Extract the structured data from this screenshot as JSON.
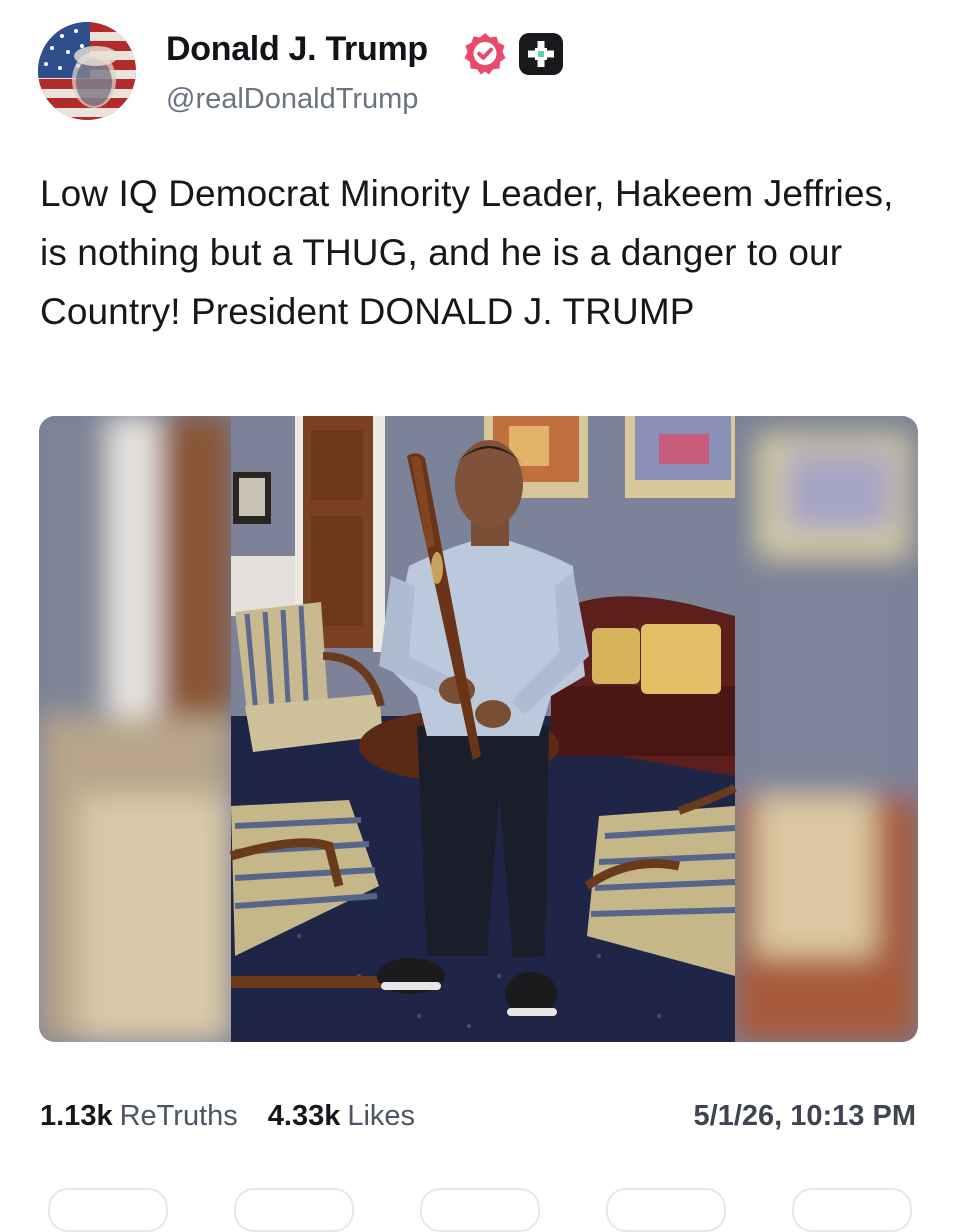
{
  "author": {
    "display_name": "Donald J. Trump",
    "handle": "@realDonaldTrump",
    "verified_icon": "verified-badge-icon",
    "plus_icon": "plus-badge-icon",
    "badge_color": "#e8496d"
  },
  "post": {
    "text": "Low IQ Democrat Minority Leader, Hakeem Jeffries, is nothing but a THUG, and he is a danger to our Country! President DONALD J. TRUMP"
  },
  "stats": {
    "retruths_count": "1.13k",
    "retruths_label": "ReTruths",
    "likes_count": "4.33k",
    "likes_label": "Likes"
  },
  "timestamp": "5/1/26, 10:13 PM"
}
